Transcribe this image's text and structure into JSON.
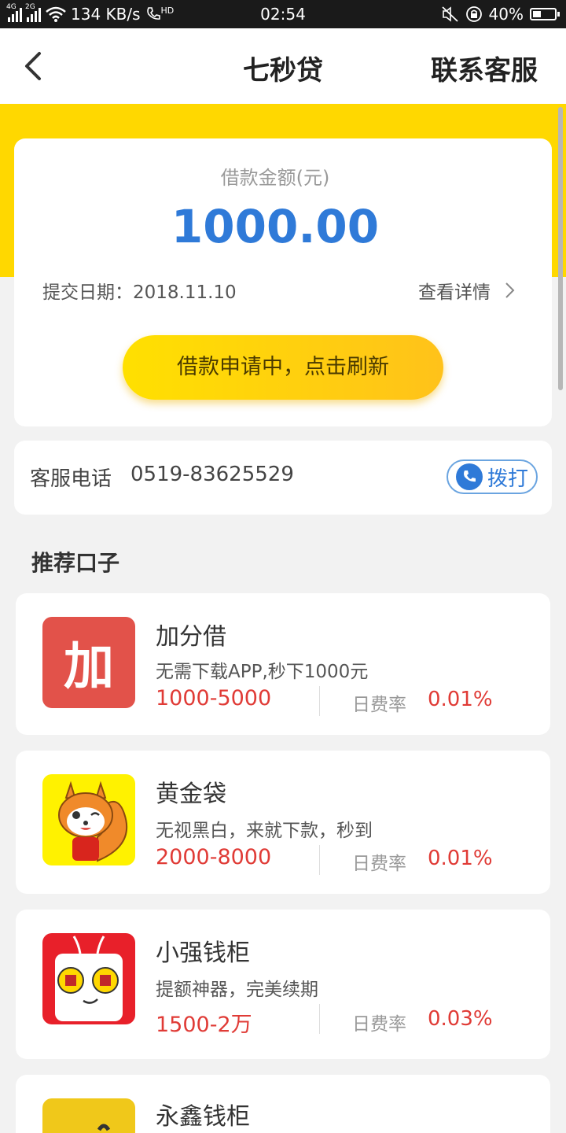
{
  "status_bar": {
    "net_speed": "134 KB/s",
    "hd": "HD",
    "time": "02:54",
    "battery": "40%",
    "battery_level": 0.4,
    "sig1_tag": "4G",
    "sig2_tag": "2G"
  },
  "header": {
    "title": "七秒贷",
    "service": "联系客服"
  },
  "loan_status": {
    "amount_label": "借款金额(元)",
    "amount": "1000.00",
    "date": "提交日期：2018.11.10",
    "detail": "查看详情",
    "refresh_button": "借款申请中，点击刷新"
  },
  "phone": {
    "label": "客服电话",
    "number": "0519-83625529",
    "dial_button": "拨打"
  },
  "recommend": {
    "title": "推荐口子",
    "items": [
      {
        "name": "加分借",
        "logo_text": "加",
        "desc": "无需下载APP,秒下1000元",
        "range": "1000-5000",
        "rate_label": "日费率",
        "rate": "0.01%"
      },
      {
        "name": "黄金袋",
        "logo_text": "",
        "desc": "无视黑白，来就下款，秒到",
        "range": "2000-8000",
        "rate_label": "日费率",
        "rate": "0.01%"
      },
      {
        "name": "小强钱柜",
        "logo_text": "",
        "desc": "提额神器，完美续期",
        "range": "1500-2万",
        "rate_label": "日费率",
        "rate": "0.03%"
      },
      {
        "name": "永鑫钱柜",
        "logo_text": "",
        "desc": "",
        "range": "",
        "rate_label": "",
        "rate": ""
      }
    ]
  },
  "colors": {
    "yellow": "#ffd800",
    "blue": "#2f7ad8",
    "red": "#e03b36"
  }
}
